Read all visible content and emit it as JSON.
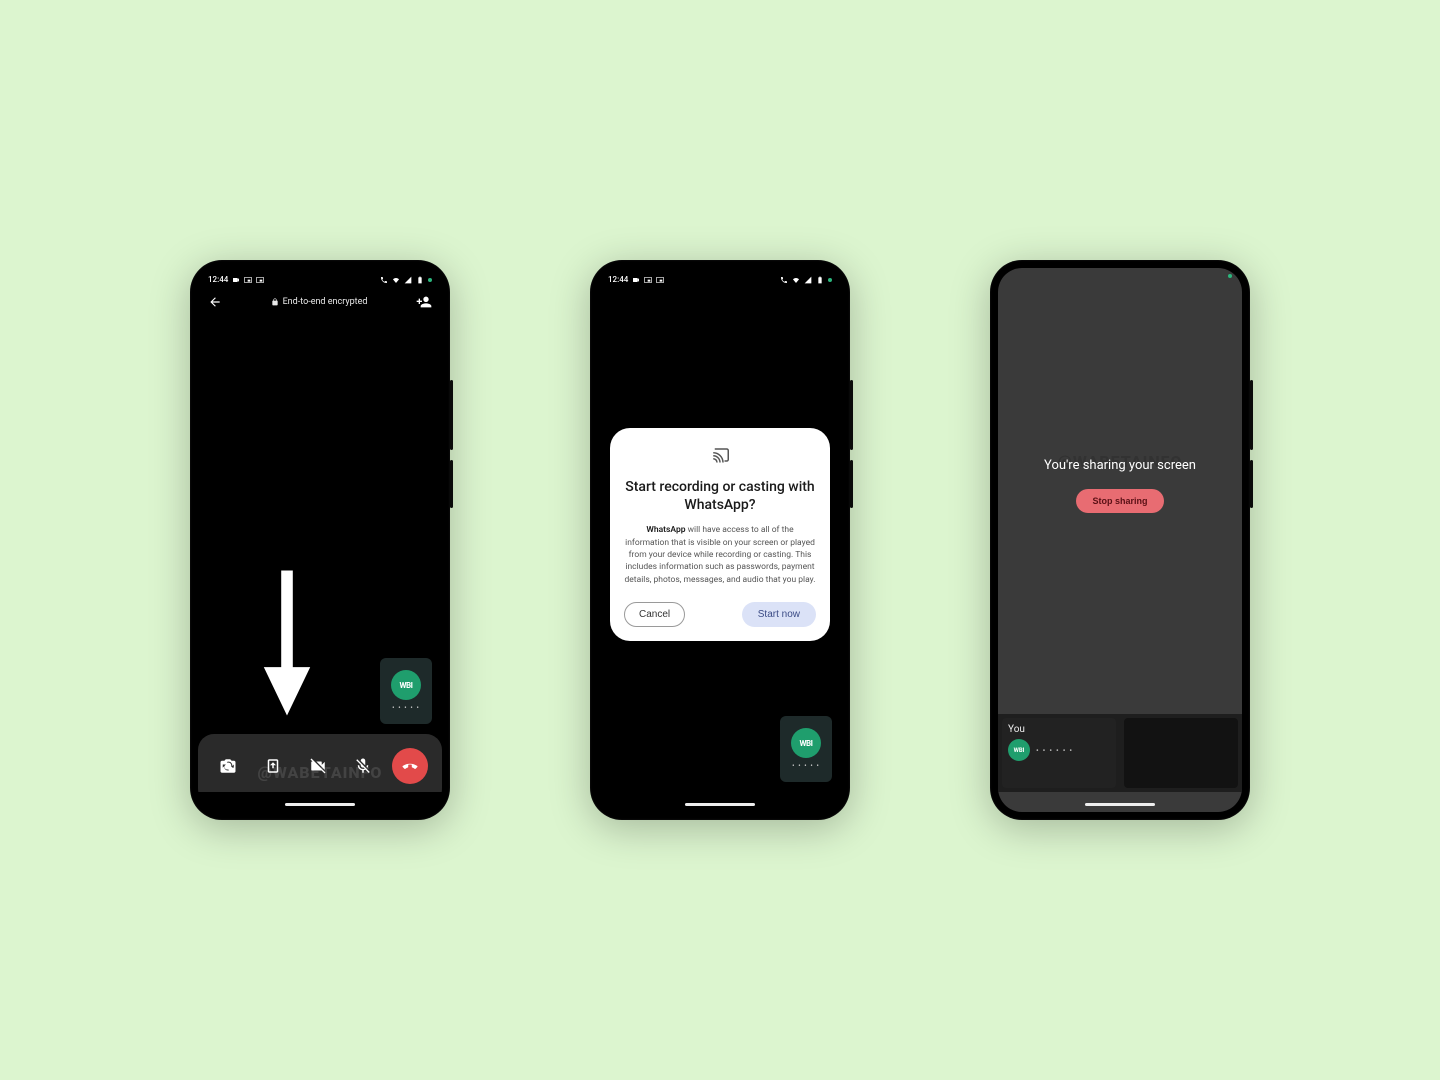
{
  "statusbar": {
    "time": "12:44"
  },
  "phone1": {
    "encrypted_label": "End-to-end encrypted",
    "pip_badge": "WBI",
    "pip_dots": "• • • • •",
    "watermark": "@WABETAINFO"
  },
  "dialog": {
    "title": "Start recording or casting with WhatsApp?",
    "app_name": "WhatsApp",
    "body_rest": " will have access to all of the information that is visible on your screen or played from your device while recording or casting. This includes information such as passwords, payment details, photos, messages, and audio that you play.",
    "cancel": "Cancel",
    "start": "Start now"
  },
  "phone3": {
    "sharing_msg": "You're sharing your screen",
    "stop_label": "Stop sharing",
    "you_label": "You",
    "badge": "WBI",
    "dots": "• • • • • •",
    "watermark": "@WABETAINFO"
  },
  "colors": {
    "bg": "#dcf5cf",
    "accent_green": "#1f9e6d",
    "danger": "#e24a4a",
    "stop_bg": "#e86c72"
  }
}
